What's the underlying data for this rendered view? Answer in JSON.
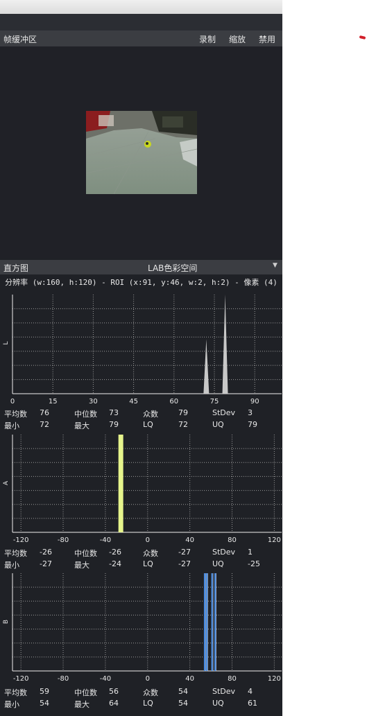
{
  "frame_buffer": {
    "title": "帧缓冲区",
    "record_label": "录制",
    "zoom_label": "缩放",
    "disable_label": "禁用"
  },
  "histogram": {
    "title": "直方图",
    "color_space": "LAB色彩空间",
    "info_line": "分辨率 (w:160, h:120) - ROI (x:91, y:46, w:2, h:2) - 像素 (4)",
    "stat_labels": {
      "mean": "平均数",
      "median": "中位数",
      "mode": "众数",
      "stdev": "StDev",
      "min": "最小",
      "max": "最大",
      "lq": "LQ",
      "uq": "UQ"
    },
    "channels": [
      {
        "ylabel": "L",
        "mean": "76",
        "median": "73",
        "mode": "79",
        "stdev": "3",
        "min": "72",
        "max": "79",
        "lq": "72",
        "uq": "79"
      },
      {
        "ylabel": "A",
        "mean": "-26",
        "median": "-26",
        "mode": "-27",
        "stdev": "1",
        "min": "-27",
        "max": "-24",
        "lq": "-27",
        "uq": "-25"
      },
      {
        "ylabel": "B",
        "mean": "59",
        "median": "56",
        "mode": "54",
        "stdev": "4",
        "min": "54",
        "max": "64",
        "lq": "54",
        "uq": "61"
      }
    ]
  },
  "colors": {
    "panel_bg": "#1f2126",
    "header_bg": "#3b3d42",
    "L_fill": "#c8c8c8",
    "A_fill": "#e6f58c",
    "B_fill": "#4a8fe8"
  },
  "chart_data": [
    {
      "type": "bar",
      "ylabel": "L",
      "xlim": [
        0,
        100
      ],
      "xticks": [
        0,
        15,
        30,
        45,
        60,
        75,
        90
      ],
      "grid": true,
      "series": [
        {
          "x": [
            72,
            79
          ],
          "values": [
            0.55,
            1.0
          ]
        }
      ]
    },
    {
      "type": "bar",
      "ylabel": "A",
      "xlim": [
        -128,
        127
      ],
      "xticks": [
        -120,
        -80,
        -40,
        0,
        40,
        80,
        120
      ],
      "grid": true,
      "series": [
        {
          "x": [
            -27,
            -26,
            -25,
            -24
          ],
          "values": [
            1.0,
            1.0,
            1.0,
            1.0
          ]
        }
      ]
    },
    {
      "type": "bar",
      "ylabel": "B",
      "xlim": [
        -128,
        127
      ],
      "xticks": [
        -120,
        -80,
        -40,
        0,
        40,
        80,
        120
      ],
      "grid": true,
      "series": [
        {
          "x": [
            54,
            56,
            61,
            64
          ],
          "values": [
            1.0,
            1.0,
            1.0,
            1.0
          ]
        }
      ]
    }
  ]
}
